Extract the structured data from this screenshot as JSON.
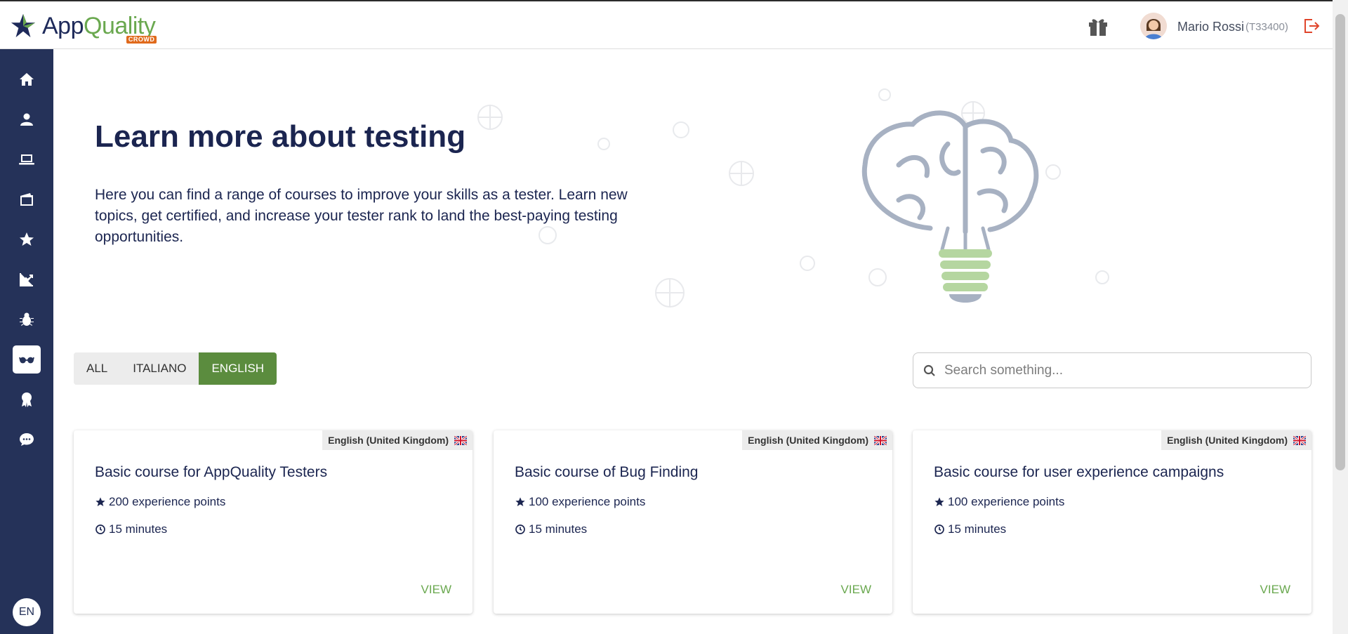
{
  "header": {
    "logo": {
      "app": "App",
      "quality": "Quality",
      "crowd": "CROWD"
    },
    "user": {
      "name": "Mario Rossi",
      "id": "(T33400)"
    }
  },
  "sidebar": {
    "items": [
      {
        "icon": "home-icon"
      },
      {
        "icon": "user-icon"
      },
      {
        "icon": "laptop-icon"
      },
      {
        "icon": "wallet-icon"
      },
      {
        "icon": "star-icon"
      },
      {
        "icon": "chart-icon"
      },
      {
        "icon": "bug-icon"
      },
      {
        "icon": "glasses-icon",
        "active": true
      },
      {
        "icon": "award-icon"
      },
      {
        "icon": "chat-icon"
      }
    ],
    "language": "EN"
  },
  "hero": {
    "title": "Learn more about testing",
    "text": "Here you can find a range of courses to improve your skills as a tester. Learn new topics, get certified, and increase your tester rank to land the best-paying testing opportunities."
  },
  "filters": {
    "options": [
      "ALL",
      "ITALIANO",
      "ENGLISH"
    ],
    "selected": "ENGLISH"
  },
  "search": {
    "placeholder": "Search something..."
  },
  "courses": [
    {
      "language": "English (United Kingdom)",
      "title": "Basic course for AppQuality Testers",
      "points": "200 experience points",
      "duration": "15 minutes",
      "action": "VIEW"
    },
    {
      "language": "English (United Kingdom)",
      "title": "Basic course of Bug Finding",
      "points": "100 experience points",
      "duration": "15 minutes",
      "action": "VIEW"
    },
    {
      "language": "English (United Kingdom)",
      "title": "Basic course for user experience campaigns",
      "points": "100 experience points",
      "duration": "15 minutes",
      "action": "VIEW"
    }
  ],
  "colors": {
    "sidebar": "#253259",
    "accent": "#5b8c3e",
    "text": "#1b2550"
  }
}
